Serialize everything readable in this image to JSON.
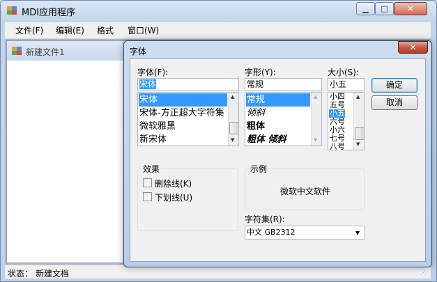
{
  "app": {
    "title": "MDI应用程序",
    "caption_buttons": [
      "minimize-icon",
      "maximize-icon",
      "close-icon"
    ]
  },
  "menu": [
    "文件(F)",
    "编辑(E)",
    "格式",
    "窗口(W)"
  ],
  "child": {
    "title": "新建文件1"
  },
  "status": {
    "label": "状态：",
    "text": "新建文档"
  },
  "dialog": {
    "title": "字体",
    "close_glyph": "✕",
    "font_label": "字体(F):",
    "font_value": "宋体",
    "fonts": [
      "宋体",
      "宋体-方正超大字符集",
      "微软雅黑",
      "新宋体"
    ],
    "style_label": "字形(Y):",
    "style_value": "常规",
    "styles": [
      "常规",
      "倾斜",
      "粗体",
      "粗体 倾斜"
    ],
    "size_label": "大小(S):",
    "size_value": "小五",
    "sizes": [
      "小四",
      "五号",
      "小五",
      "六号",
      "小六",
      "七号",
      "八号"
    ],
    "ok": "确定",
    "cancel": "取消",
    "effects_label": "效果",
    "strike": "删除线(K)",
    "underline": "下划线(U)",
    "sample_label": "示例",
    "sample_text": "微软中文软件",
    "charset_label": "字符集(R):",
    "charset_value": "中文 GB2312"
  },
  "colors": {
    "selection": "#3399ff",
    "close_button": "#c75a45",
    "mdi_background": "#abb6c6"
  }
}
